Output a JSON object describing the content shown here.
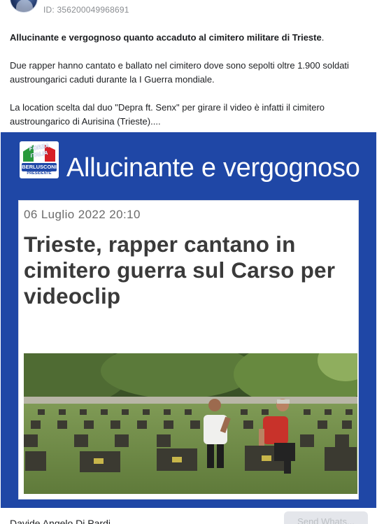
{
  "post": {
    "id_label": "ID: 356200049968691",
    "headline": "Allucinante e vergognoso quanto accaduto al cimitero militare di Trieste",
    "headline_suffix": ".",
    "paragraph_1": "Due rapper hanno cantato e ballato nel cimitero dove sono sepolti oltre 1.900 soldati austroungarici caduti durante la I Guerra mondiale.",
    "paragraph_2": "La location scelta dal duo \"Depra ft. Senx\" per girare il video è infatti il cimitero austroungarico di Aurisina (Trieste)...."
  },
  "image_card": {
    "logo_top": "FORZA",
    "logo_mid": "ITALIA",
    "logo_name": "BERLUSCONI",
    "logo_sub": "PRESIDENTE",
    "title": "Allucinante e vergognoso",
    "background_color": "#1f47a6"
  },
  "article": {
    "date": "06 Luglio 2022  20:10",
    "headline": "Trieste, rapper cantano in cimitero guerra sul Carso per videoclip"
  },
  "footer": {
    "author": "Davide Angelo Di Pardi",
    "button_label": "Send Whats..."
  }
}
